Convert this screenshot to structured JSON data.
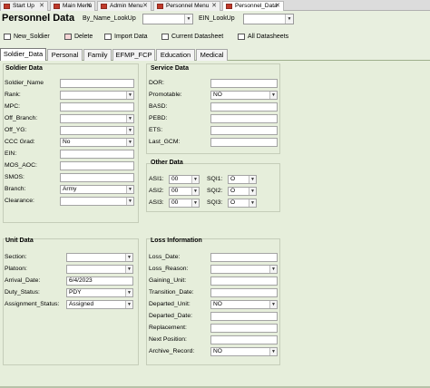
{
  "doc_tabs": [
    "Start Up",
    "Main Menu",
    "Admin Menu",
    "Personnel Menu",
    "Personnel_Data"
  ],
  "header": {
    "title": "Personnel Data",
    "lookup_name_label": "By_Name_LookUp",
    "ein_lookup_label": "EIN_LookUp"
  },
  "toolbar": {
    "new_soldier": "New_Soldier",
    "delete": "Delete",
    "import_data": "Import Data",
    "current_datasheet": "Current Datasheet",
    "all_datasheets": "All Datasheets"
  },
  "section_tabs": [
    "Soldier_Data",
    "Personal",
    "Family",
    "EFMP_FCP",
    "Education",
    "Medical"
  ],
  "soldier_data": {
    "title": "Soldier Data",
    "fields": [
      {
        "label": "Soldier_Name",
        "value": ""
      },
      {
        "label": "Rank:",
        "value": ""
      },
      {
        "label": "MPC:",
        "value": ""
      },
      {
        "label": "Off_Branch:",
        "value": ""
      },
      {
        "label": "Off_YG:",
        "value": ""
      },
      {
        "label": "CCC Grad:",
        "value": "No"
      },
      {
        "label": "EIN:",
        "value": ""
      },
      {
        "label": "MOS_AOC:",
        "value": ""
      },
      {
        "label": "SMOS:",
        "value": ""
      },
      {
        "label": "Branch:",
        "value": "Army"
      },
      {
        "label": "Clearance:",
        "value": ""
      }
    ]
  },
  "service_data": {
    "title": "Service Data",
    "fields": [
      {
        "label": "DOR:",
        "value": ""
      },
      {
        "label": "Promotable:",
        "value": "NO"
      },
      {
        "label": "BASD:",
        "value": ""
      },
      {
        "label": "PEBD:",
        "value": ""
      },
      {
        "label": "ETS:",
        "value": ""
      },
      {
        "label": "Last_GCM:",
        "value": ""
      }
    ]
  },
  "other_data": {
    "title": "Other Data",
    "asi": [
      {
        "label": "ASI1:",
        "value": "00"
      },
      {
        "label": "ASI2:",
        "value": "00"
      },
      {
        "label": "ASI3:",
        "value": "00"
      }
    ],
    "sqi": [
      {
        "label": "SQI1:",
        "value": "O"
      },
      {
        "label": "SQI2:",
        "value": "O"
      },
      {
        "label": "SQI3:",
        "value": "O"
      }
    ]
  },
  "unit_data": {
    "title": "Unit Data",
    "fields": [
      {
        "label": "Section:",
        "value": ""
      },
      {
        "label": "Platoon:",
        "value": ""
      },
      {
        "label": "Arrival_Date:",
        "value": "6/4/2023"
      },
      {
        "label": "Duty_Status:",
        "value": "PDY"
      },
      {
        "label": "Assignment_Status:",
        "value": "Assigned"
      }
    ]
  },
  "loss_info": {
    "title": "Loss Information",
    "fields": [
      {
        "label": "Loss_Date:",
        "value": ""
      },
      {
        "label": "Loss_Reason:",
        "value": ""
      },
      {
        "label": "Gaining_Unit:",
        "value": ""
      },
      {
        "label": "Transition_Date:",
        "value": ""
      },
      {
        "label": "Departed_Unit:",
        "value": "NO"
      },
      {
        "label": "Departed_Date:",
        "value": ""
      },
      {
        "label": "Replacement:",
        "value": ""
      },
      {
        "label": "Next Position:",
        "value": ""
      },
      {
        "label": "Archive_Record:",
        "value": "NO"
      }
    ]
  }
}
